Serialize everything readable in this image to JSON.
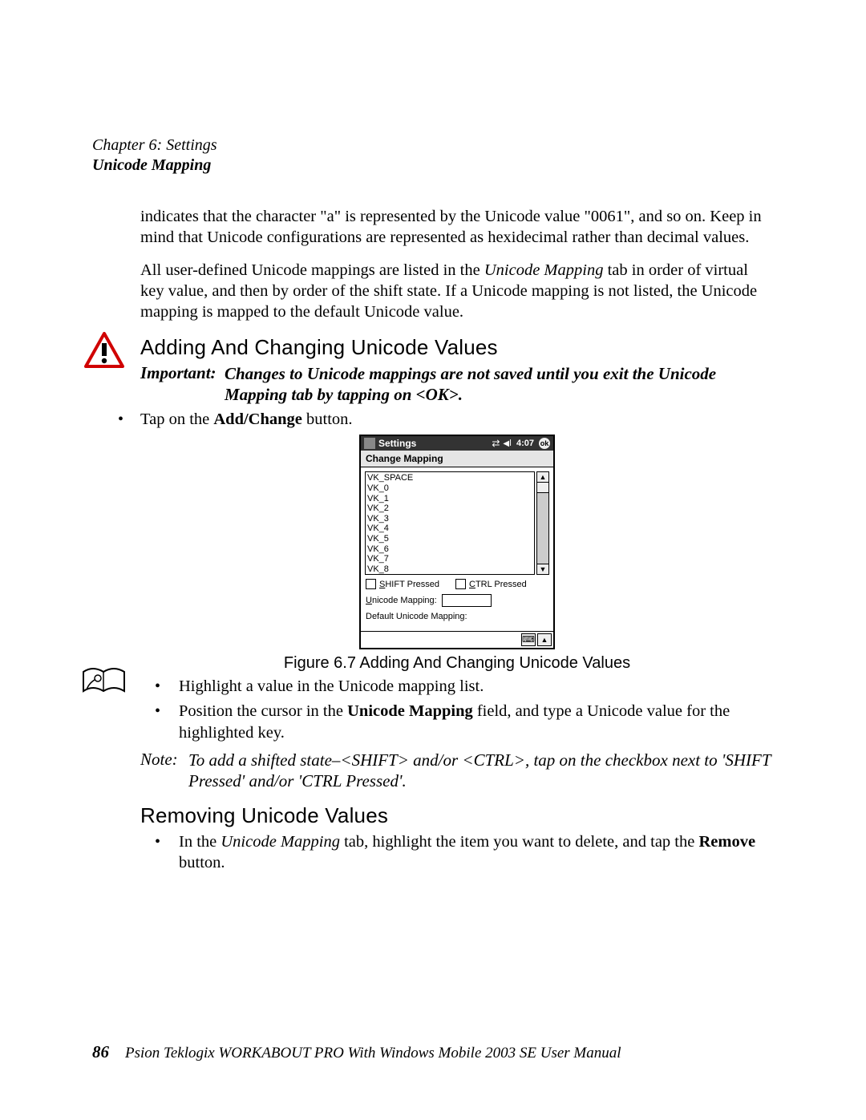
{
  "header": {
    "chapter": "Chapter 6:  Settings",
    "section": "Unicode Mapping"
  },
  "body": {
    "p1": "indicates that the character \"a\" is represented by the Unicode value \"0061\", and so on. Keep in mind that Unicode configurations are represented as hexidecimal rather than decimal values.",
    "p2_pre": "All user-defined Unicode mappings are listed in the ",
    "p2_em": "Unicode Mapping",
    "p2_post": " tab in order of virtual key value, and then by order of the shift state. If a Unicode mapping is not listed, the Unicode mapping is mapped to the default Unicode value.",
    "h3_add": "Adding And Changing Unicode Values",
    "important_label": "Important:",
    "important_body": "Changes to Unicode mappings are not saved until you exit the Unicode Mapping tab by tapping on <OK>.",
    "bullet_addchange_pre": "Tap on the ",
    "bullet_addchange_bold": "Add/Change",
    "bullet_addchange_post": " button.",
    "figure_caption": "Figure 6.7 Adding And Changing Unicode Values",
    "bullet2_a": "Highlight a value in the Unicode mapping list.",
    "bullet2_b_pre": "Position the cursor in the ",
    "bullet2_b_bold": "Unicode Mapping",
    "bullet2_b_post": " field, and type a Unicode value for the highlighted key.",
    "note_label": "Note:",
    "note_body_pre": "To add a shifted state",
    "note_body_dash": "–",
    "note_body_post": "<SHIFT> and/or <CTRL>, tap on the checkbox next to 'SHIFT Pressed' and/or 'CTRL Pressed'.",
    "h3_remove": "Removing Unicode Values",
    "bullet_remove_pre": "In the ",
    "bullet_remove_em": "Unicode Mapping",
    "bullet_remove_mid": " tab, highlight the item you want to delete, and tap the ",
    "bullet_remove_bold": "Remove",
    "bullet_remove_post": " button."
  },
  "device": {
    "title": "Settings",
    "time": "4:07",
    "ok": "ok",
    "tab": "Change Mapping",
    "list_items": [
      "VK_SPACE",
      "VK_0",
      "VK_1",
      "VK_2",
      "VK_3",
      "VK_4",
      "VK_5",
      "VK_6",
      "VK_7",
      "VK_8"
    ],
    "shift_s": "S",
    "shift_rest": "HIFT Pressed",
    "ctrl_c": "C",
    "ctrl_rest": "TRL Pressed",
    "um_u": "U",
    "um_rest": "nicode Mapping:",
    "default_um": "Default Unicode Mapping:"
  },
  "footer": {
    "page_number": "86",
    "text": "Psion Teklogix WORKABOUT PRO With Windows Mobile 2003 SE User Manual"
  }
}
